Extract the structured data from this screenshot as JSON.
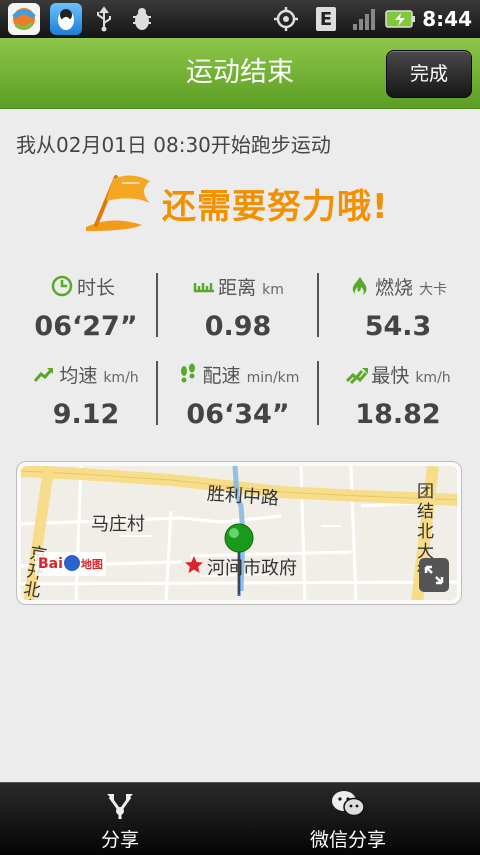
{
  "status_bar": {
    "time": "8:44",
    "icons": [
      "app-launcher-icon",
      "qq-penguin-icon",
      "usb-icon",
      "bug-debug-icon",
      "gps-icon",
      "e-network-icon",
      "signal-icon",
      "battery-charging-icon"
    ]
  },
  "header": {
    "title": "运动结束",
    "done_label": "完成"
  },
  "summary": {
    "start_text": "我从02月01日 08:30开始跑步运动",
    "encourage_text": "还需要努力哦!"
  },
  "stats": [
    {
      "label": "时长",
      "unit": "",
      "value": "06‘27”",
      "icon": "clock-icon"
    },
    {
      "label": "距离",
      "unit": "km",
      "value": "0.98",
      "icon": "ruler-icon"
    },
    {
      "label": "燃烧",
      "unit": "大卡",
      "value": "54.3",
      "icon": "flame-icon"
    },
    {
      "label": "均速",
      "unit": "km/h",
      "value": "9.12",
      "icon": "trend-arrow-icon"
    },
    {
      "label": "配速",
      "unit": "min/km",
      "value": "06‘34”",
      "icon": "footprints-icon"
    },
    {
      "label": "最快",
      "unit": "km/h",
      "value": "18.82",
      "icon": "fast-arrows-icon"
    }
  ],
  "map": {
    "labels": {
      "shengli": "胜利中路",
      "mazhuang": "马庄村",
      "jingkai": "京开北大",
      "tuanjie": "团结北大街",
      "gov": "河间市政府"
    },
    "logo_text": "Bai",
    "logo_text2": "地图"
  },
  "bottom_bar": {
    "share_label": "分享",
    "wechat_label": "微信分享"
  },
  "colors": {
    "accent_green": "#6aaa2c",
    "encourage_orange": "#f29000",
    "icon_green": "#5aa82a"
  }
}
